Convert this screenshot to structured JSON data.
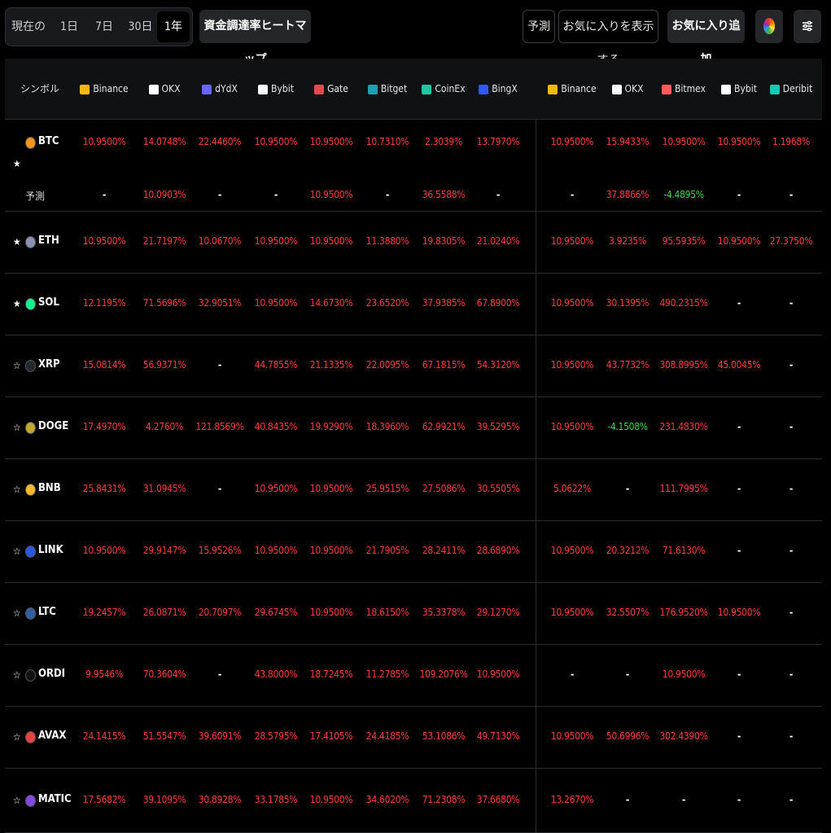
{
  "toolbar": {
    "periods": [
      "現在の",
      "1日",
      "7日",
      "30日",
      "1年"
    ],
    "active_period": "1年",
    "heatmap_label": "資金調達率ヒートマップ",
    "predict_label": "予測",
    "show_favorites_label": "お気に入りを表示する",
    "add_favorite_label": "お気に入り追加",
    "icons": {
      "heatmap": "color-wheel-icon",
      "filter": "sliders-icon"
    }
  },
  "table": {
    "symbol_header": "シンボル",
    "prediction_label": "予測",
    "exchanges": [
      {
        "name": "Binance",
        "logo_color": "#f0b90b",
        "icon": "binance-icon"
      },
      {
        "name": "OKX",
        "logo_color": "#ffffff",
        "icon": "okx-icon"
      },
      {
        "name": "dYdX",
        "logo_color": "#6966ff",
        "icon": "dydx-icon"
      },
      {
        "name": "Bybit",
        "logo_color": "#ffffff",
        "icon": "bybit-icon"
      },
      {
        "name": "Gate",
        "logo_color": "#e5484d",
        "icon": "gate-icon"
      },
      {
        "name": "Bitget",
        "logo_color": "#1da2b4",
        "icon": "bitget-icon"
      },
      {
        "name": "CoinEx",
        "logo_color": "#1fc7a5",
        "icon": "coinex-icon"
      },
      {
        "name": "BingX",
        "logo_color": "#2a5aff",
        "icon": "bingx-icon"
      },
      {
        "name": "Binance",
        "logo_color": "#f0b90b",
        "icon": "binance-icon"
      },
      {
        "name": "OKX",
        "logo_color": "#ffffff",
        "icon": "okx-icon"
      },
      {
        "name": "Bitmex",
        "logo_color": "#ff5a5a",
        "icon": "bitmex-icon"
      },
      {
        "name": "Bybit",
        "logo_color": "#ffffff",
        "icon": "bybit-icon"
      },
      {
        "name": "Deribit",
        "logo_color": "#14c8b4",
        "icon": "deribit-icon"
      }
    ],
    "rows": [
      {
        "symbol": "BTC",
        "favorite": true,
        "logo_color": "#f7931a",
        "values": [
          "10.9500%",
          "14.0748%",
          "22.4460%",
          "10.9500%",
          "10.9500%",
          "10.7310%",
          "2.3039%",
          "13.7970%",
          "10.9500%",
          "15.9433%",
          "10.9500%",
          "10.9500%",
          "1.1968%"
        ],
        "predicted": [
          "-",
          "10.0903%",
          "-",
          "-",
          "10.9500%",
          "-",
          "36.5588%",
          "-",
          "-",
          "37.8866%",
          "-4.4895%",
          "-",
          "-"
        ]
      },
      {
        "symbol": "ETH",
        "favorite": true,
        "logo_color": "#8a92b2",
        "values": [
          "10.9500%",
          "21.7197%",
          "10.0670%",
          "10.9500%",
          "10.9500%",
          "11.3880%",
          "19.8305%",
          "21.0240%",
          "10.9500%",
          "3.9235%",
          "95.5935%",
          "10.9500%",
          "27.3750%"
        ]
      },
      {
        "symbol": "SOL",
        "favorite": true,
        "logo_color": "#14f195",
        "values": [
          "12.1195%",
          "71.5696%",
          "32.9051%",
          "10.9500%",
          "14.6730%",
          "23.6520%",
          "37.9385%",
          "67.8900%",
          "10.9500%",
          "30.1395%",
          "490.2315%",
          "-",
          "-"
        ]
      },
      {
        "symbol": "XRP",
        "favorite": false,
        "logo_color": "#23292f",
        "values": [
          "15.0814%",
          "56.9371%",
          "-",
          "44.7855%",
          "21.1335%",
          "22.0095%",
          "67.1815%",
          "54.3120%",
          "10.9500%",
          "43.7732%",
          "308.8995%",
          "45.0045%",
          "-"
        ]
      },
      {
        "symbol": "DOGE",
        "favorite": false,
        "logo_color": "#c2a633",
        "values": [
          "17.4970%",
          "4.2760%",
          "121.8569%",
          "40.8435%",
          "19.9290%",
          "18.3960%",
          "62.9921%",
          "39.5295%",
          "10.9500%",
          "-4.1508%",
          "231.4830%",
          "-",
          "-"
        ]
      },
      {
        "symbol": "BNB",
        "favorite": false,
        "logo_color": "#f3ba2f",
        "values": [
          "25.8431%",
          "31.0945%",
          "-",
          "10.9500%",
          "10.9500%",
          "25.9515%",
          "27.5086%",
          "30.5505%",
          "5.0622%",
          "-",
          "111.7995%",
          "-",
          "-"
        ]
      },
      {
        "symbol": "LINK",
        "favorite": false,
        "logo_color": "#2a5ada",
        "values": [
          "10.9500%",
          "29.9147%",
          "15.9526%",
          "10.9500%",
          "10.9500%",
          "21.7905%",
          "28.2411%",
          "28.6890%",
          "10.9500%",
          "20.3212%",
          "71.6130%",
          "-",
          "-"
        ]
      },
      {
        "symbol": "LTC",
        "favorite": false,
        "logo_color": "#345d9d",
        "values": [
          "19.2457%",
          "26.0871%",
          "20.7097%",
          "29.6745%",
          "10.9500%",
          "18.6150%",
          "35.3378%",
          "29.1270%",
          "10.9500%",
          "32.5507%",
          "176.9520%",
          "10.9500%",
          "-"
        ]
      },
      {
        "symbol": "ORDI",
        "favorite": false,
        "logo_color": "#111111",
        "values": [
          "9.9546%",
          "70.3604%",
          "-",
          "43.8000%",
          "18.7245%",
          "11.2785%",
          "109.2076%",
          "10.9500%",
          "-",
          "-",
          "10.9500%",
          "-",
          "-"
        ]
      },
      {
        "symbol": "AVAX",
        "favorite": false,
        "logo_color": "#e84142",
        "values": [
          "24.1415%",
          "51.5547%",
          "39.6091%",
          "28.5795%",
          "17.4105%",
          "24.4185%",
          "53.1086%",
          "49.7130%",
          "10.9500%",
          "50.6996%",
          "302.4390%",
          "-",
          "-"
        ]
      },
      {
        "symbol": "MATIC",
        "favorite": false,
        "logo_color": "#8247e5",
        "values": [
          "17.5682%",
          "39.1095%",
          "30.8928%",
          "33.1785%",
          "10.9500%",
          "34.6020%",
          "71.2308%",
          "37.6680%",
          "13.2670%",
          "-",
          "-",
          "-",
          "-"
        ]
      }
    ]
  }
}
